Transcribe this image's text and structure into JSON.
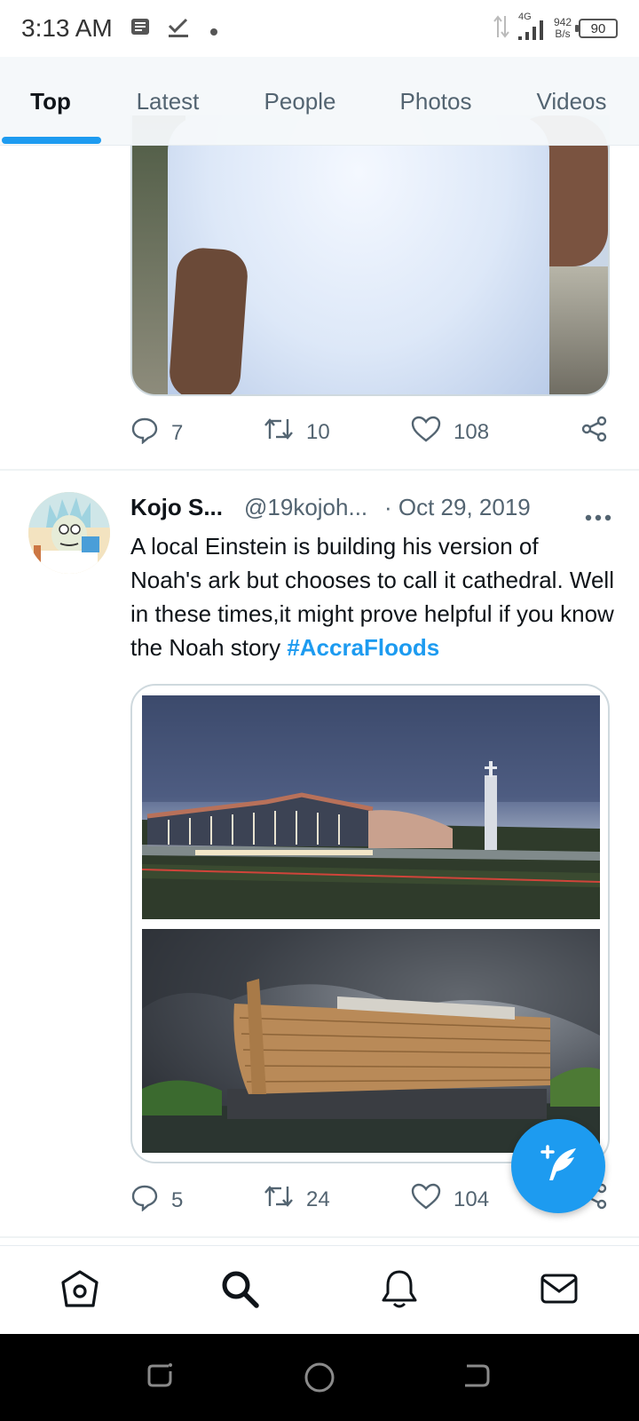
{
  "status_bar": {
    "time": "3:13 AM",
    "network_type": "4G",
    "net_speed_value": "942",
    "net_speed_unit": "B/s",
    "battery_level": "90"
  },
  "tabs": [
    {
      "label": "Top",
      "active": true
    },
    {
      "label": "Latest",
      "active": false
    },
    {
      "label": "People",
      "active": false
    },
    {
      "label": "Photos",
      "active": false
    },
    {
      "label": "Videos",
      "active": false
    }
  ],
  "previous_tweet": {
    "replies": "7",
    "retweets": "10",
    "likes": "108"
  },
  "tweet": {
    "author_name": "Kojo S...",
    "handle": "@19kojoh...",
    "date": "· Oct 29, 2019",
    "text": "A local Einstein is building his version of Noah's ark but chooses to call it cathedral. Well in these times,it might prove helpful if you know the Noah story ",
    "hashtag": "#AccraFloods",
    "replies": "5",
    "retweets": "24",
    "likes": "104"
  },
  "colors": {
    "accent": "#1d9bf0",
    "text_primary": "#0f1419",
    "text_secondary": "#536471"
  },
  "icons": {
    "reply": "speech-bubble-icon",
    "retweet": "retweet-icon",
    "like": "heart-icon",
    "share": "share-icon",
    "compose": "feather-plus-icon",
    "home": "home-icon",
    "search": "search-icon",
    "notifications": "bell-icon",
    "messages": "envelope-icon"
  }
}
